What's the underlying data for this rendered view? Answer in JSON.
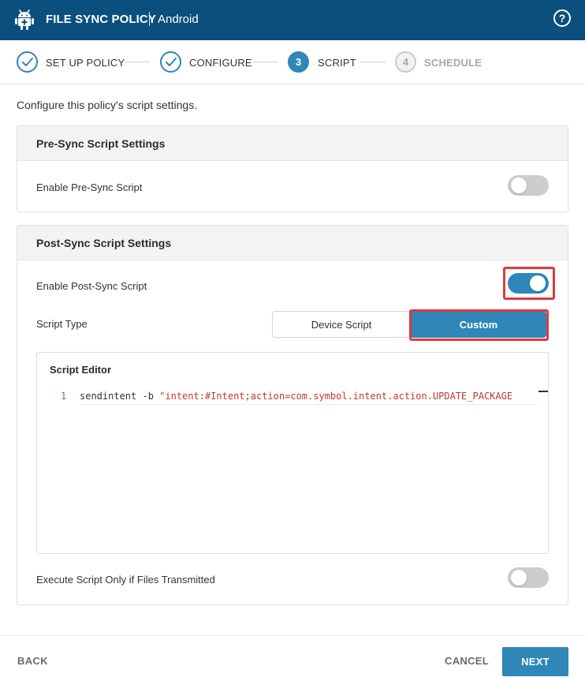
{
  "header": {
    "title": "FILE SYNC POLICY",
    "subtitle": "Android",
    "help_icon": "question-circle-icon",
    "help_glyph": "?"
  },
  "stepper": {
    "steps": [
      {
        "number": "1",
        "label": "SET UP POLICY",
        "state": "done"
      },
      {
        "number": "2",
        "label": "CONFIGURE",
        "state": "done"
      },
      {
        "number": "3",
        "label": "SCRIPT",
        "state": "active"
      },
      {
        "number": "4",
        "label": "SCHEDULE",
        "state": "todo"
      }
    ]
  },
  "intro": "Configure this policy's script settings.",
  "pre_sync": {
    "title": "Pre-Sync Script Settings",
    "enable_label": "Enable Pre-Sync Script",
    "enabled": false
  },
  "post_sync": {
    "title": "Post-Sync Script Settings",
    "enable_label": "Enable Post-Sync Script",
    "enabled": true,
    "script_type_label": "Script Type",
    "script_type_options": [
      "Device Script",
      "Custom"
    ],
    "script_type_selected": "Custom",
    "editor": {
      "title": "Script Editor",
      "line_number": "1",
      "code_plain": "sendintent -b ",
      "code_string": "\"intent:#Intent;action=com.symbol.intent.action.UPDATE_PACKAGE"
    },
    "execute_only_label": "Execute Script Only if Files Transmitted",
    "execute_only_enabled": false
  },
  "footer": {
    "back_label": "BACK",
    "cancel_label": "CANCEL",
    "next_label": "NEXT"
  },
  "colors": {
    "header_bg": "#0a4f7e",
    "accent": "#2f86b8",
    "highlight": "#e03b3b"
  }
}
